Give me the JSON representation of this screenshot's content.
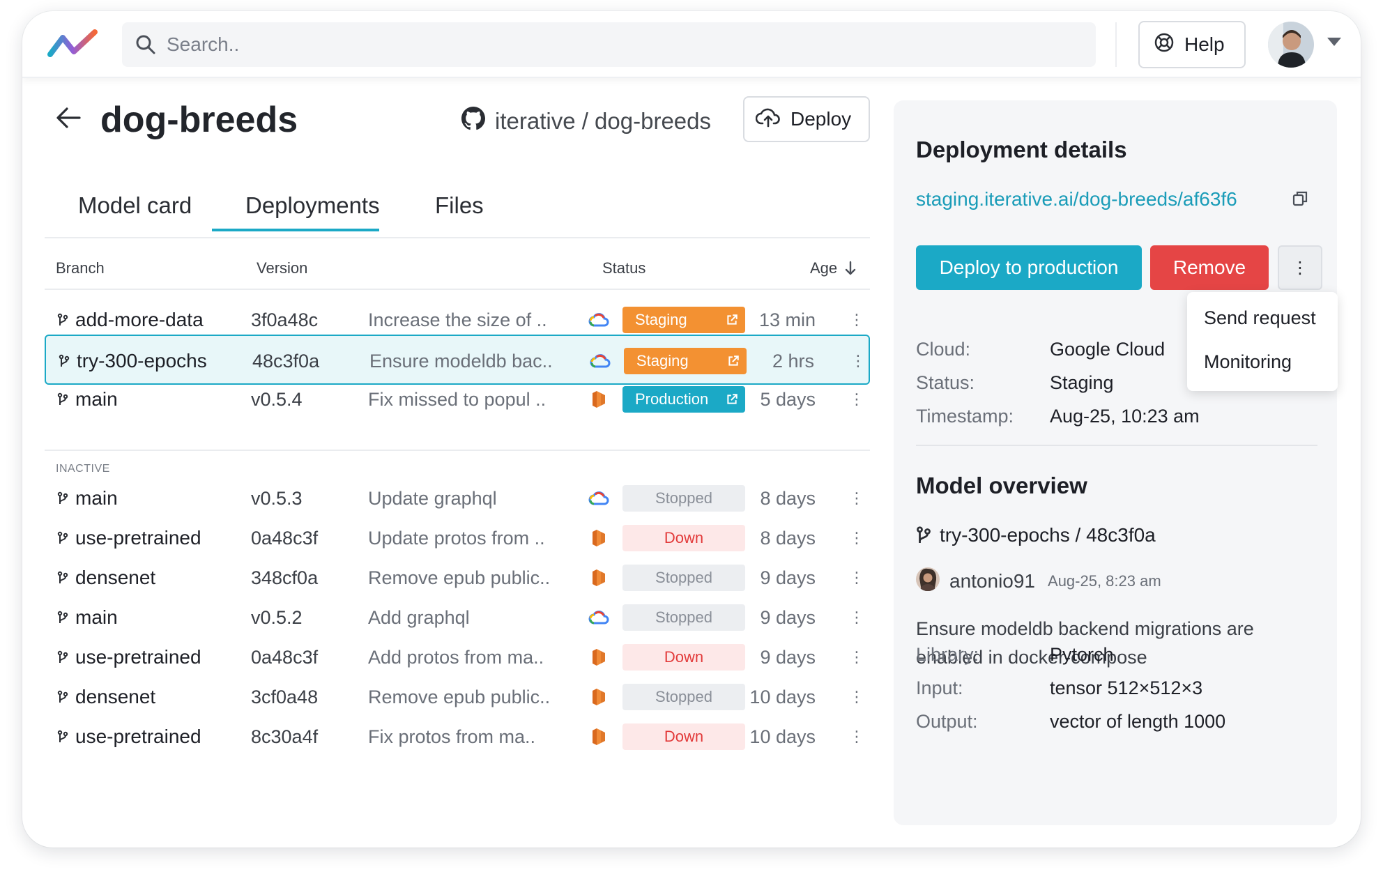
{
  "header": {
    "search_placeholder": "Search..",
    "help_label": "Help"
  },
  "project": {
    "title": "dog-breeds",
    "repo": "iterative / dog-breeds",
    "deploy_label": "Deploy"
  },
  "tabs": [
    {
      "label": "Model card",
      "active": false
    },
    {
      "label": "Deployments",
      "active": true
    },
    {
      "label": "Files",
      "active": false
    }
  ],
  "table": {
    "headers": {
      "branch": "Branch",
      "version": "Version",
      "status": "Status",
      "age": "Age"
    },
    "inactive_label": "INACTIVE",
    "active_rows": [
      {
        "branch": "add-more-data",
        "version": "3f0a48c",
        "message": "Increase the size of ..",
        "cloud": "gcp",
        "status": "Staging",
        "status_type": "staging",
        "age": "13 min",
        "selected": false
      },
      {
        "branch": "try-300-epochs",
        "version": "48c3f0a",
        "message": "Ensure modeldb bac..",
        "cloud": "gcp",
        "status": "Staging",
        "status_type": "staging",
        "age": "2 hrs",
        "selected": true
      },
      {
        "branch": "main",
        "version": "v0.5.4",
        "message": "Fix missed to popul ..",
        "cloud": "aws",
        "status": "Production",
        "status_type": "production",
        "age": "5 days",
        "selected": false
      }
    ],
    "inactive_rows": [
      {
        "branch": "main",
        "version": "v0.5.3",
        "message": "Update graphql",
        "cloud": "gcp",
        "status": "Stopped",
        "status_type": "stopped",
        "age": "8 days"
      },
      {
        "branch": "use-pretrained",
        "version": "0a48c3f",
        "message": "Update protos from ..",
        "cloud": "aws",
        "status": "Down",
        "status_type": "down",
        "age": "8 days"
      },
      {
        "branch": "densenet",
        "version": "348cf0a",
        "message": "Remove epub public..",
        "cloud": "aws",
        "status": "Stopped",
        "status_type": "stopped",
        "age": "9 days"
      },
      {
        "branch": "main",
        "version": "v0.5.2",
        "message": "Add graphql",
        "cloud": "gcp",
        "status": "Stopped",
        "status_type": "stopped",
        "age": "9 days"
      },
      {
        "branch": "use-pretrained",
        "version": "0a48c3f",
        "message": "Add protos from ma..",
        "cloud": "aws",
        "status": "Down",
        "status_type": "down",
        "age": "9 days"
      },
      {
        "branch": "densenet",
        "version": "3cf0a48",
        "message": "Remove epub public..",
        "cloud": "aws",
        "status": "Stopped",
        "status_type": "stopped",
        "age": "10 days"
      },
      {
        "branch": "use-pretrained",
        "version": "8c30a4f",
        "message": "Fix protos from ma..",
        "cloud": "aws",
        "status": "Down",
        "status_type": "down",
        "age": "10 days"
      }
    ]
  },
  "details": {
    "title": "Deployment details",
    "url": "staging.iterative.ai/dog-breeds/af63f6",
    "deploy_prod_label": "Deploy to production",
    "remove_label": "Remove",
    "menu": [
      "Send request",
      "Monitoring"
    ],
    "fields": [
      {
        "key": "Cloud:",
        "value": "Google Cloud"
      },
      {
        "key": "Status:",
        "value": "Staging"
      },
      {
        "key": "Timestamp:",
        "value": "Aug-25, 10:23 am"
      }
    ]
  },
  "overview": {
    "title": "Model overview",
    "commit": "try-300-epochs / 48c3f0a",
    "author": "antonio91",
    "date": "Aug-25, 8:23 am",
    "description": "Ensure modeldb backend migrations are enabled in docker-compose",
    "fields": [
      {
        "key": "Library:",
        "value": "Pytorch"
      },
      {
        "key": "Input:",
        "value": "tensor 512×512×3"
      },
      {
        "key": "Output:",
        "value": "vector of length 1000"
      }
    ]
  },
  "colors": {
    "accent": "#1ba9c6",
    "staging": "#f39132",
    "danger": "#e54545"
  }
}
